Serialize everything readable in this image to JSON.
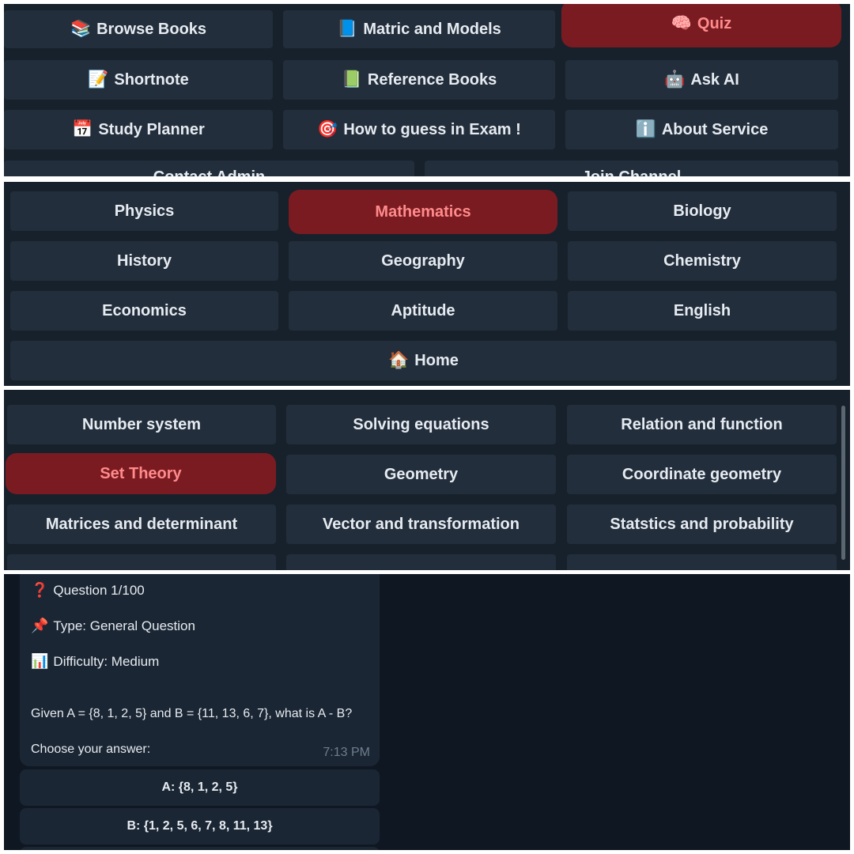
{
  "main_menu": [
    {
      "icon": "📚",
      "label": "Browse Books"
    },
    {
      "icon": "📘",
      "label": "Matric and Models"
    },
    {
      "icon": "🧠",
      "label": "Quiz",
      "active": true
    },
    {
      "icon": "📝",
      "label": "Shortnote"
    },
    {
      "icon": "📗",
      "label": "Reference Books"
    },
    {
      "icon": "🤖",
      "label": "Ask AI"
    },
    {
      "icon": "📅",
      "label": "Study Planner"
    },
    {
      "icon": "🎯",
      "label": "How to guess in Exam !"
    },
    {
      "icon": "ℹ️",
      "label": "About Service"
    }
  ],
  "main_menu_partial": [
    {
      "label": "Contact Admin"
    },
    {
      "label": "Join Channel"
    }
  ],
  "subjects": [
    {
      "label": "Physics"
    },
    {
      "label": "Mathematics",
      "active": true
    },
    {
      "label": "Biology"
    },
    {
      "label": "History"
    },
    {
      "label": "Geography"
    },
    {
      "label": "Chemistry"
    },
    {
      "label": "Economics"
    },
    {
      "label": "Aptitude"
    },
    {
      "label": "English"
    }
  ],
  "home_button": {
    "icon": "🏠",
    "label": "Home"
  },
  "topics": [
    {
      "label": "Number system"
    },
    {
      "label": "Solving equations"
    },
    {
      "label": "Relation and function"
    },
    {
      "label": "Set Theory",
      "active": true
    },
    {
      "label": "Geometry"
    },
    {
      "label": "Coordinate geometry"
    },
    {
      "label": "Matrices and determinant"
    },
    {
      "label": "Vector and transformation"
    },
    {
      "label": "Statstics and probability"
    }
  ],
  "question": {
    "header": {
      "icon": "❓",
      "text": "Question 1/100"
    },
    "type": {
      "icon": "📌",
      "text": "Type: General Question"
    },
    "difficulty": {
      "icon": "📊",
      "text": "Difficulty: Medium"
    },
    "body": "Given A = {8, 1, 2, 5} and B = {11, 13, 6, 7}, what is A - B?",
    "prompt": "Choose your answer:",
    "time": "7:13 PM"
  },
  "answers": [
    {
      "label": "A: {8, 1, 2, 5}"
    },
    {
      "label": "B: {1, 2, 5, 6, 7, 8, 11, 13}"
    }
  ],
  "colors": {
    "panel_bg": "#17212b",
    "button_bg": "#232e3c",
    "active_bg": "#7a1b22",
    "active_text": "#ff8b8b",
    "chat_bg": "#0f1722"
  }
}
